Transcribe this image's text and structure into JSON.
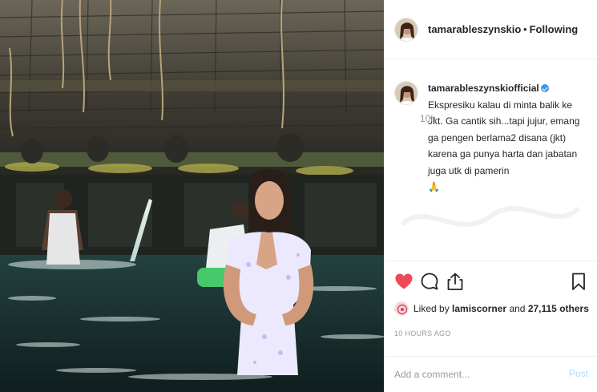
{
  "header": {
    "username": "tamarableszynskiofficial",
    "separator": "•",
    "follow_status": "Following"
  },
  "caption": {
    "username": "tamarableszynskiofficial",
    "text": "Ekspresiku kalau di minta balik ke Jkt. Ga cantik sih...tapi jujur, emang ga pengen berlama2 disana (jkt) karena ga punya harta dan jabatan juga utk di pamerin",
    "emoji": "🙏",
    "time": "10h"
  },
  "actions": {
    "like_icon": "heart-icon",
    "comment_icon": "comment-icon",
    "share_icon": "share-icon",
    "save_icon": "bookmark-icon",
    "like_color": "#ed4956"
  },
  "likes": {
    "prefix": "Liked by",
    "liked_user": "lamiscorner",
    "conjunction": "and",
    "count": "27,115 others"
  },
  "posted_time": "10 HOURS AGO",
  "comment": {
    "placeholder": "Add a comment...",
    "post_label": "Post"
  }
}
